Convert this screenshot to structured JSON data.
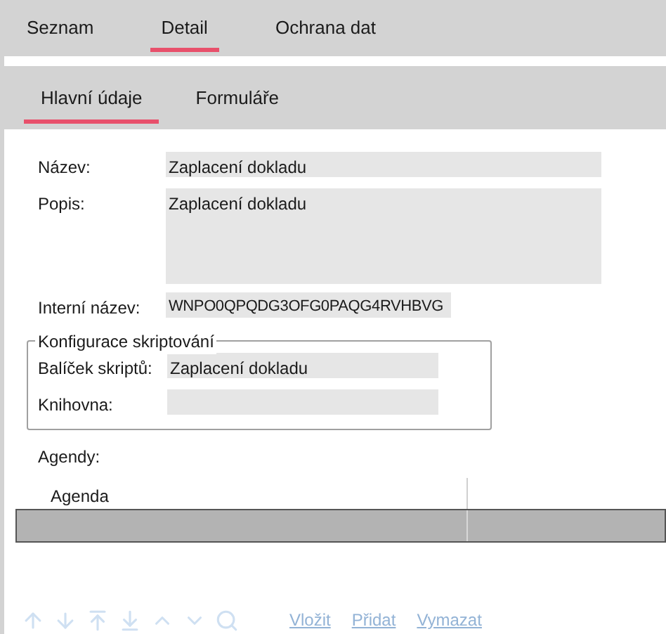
{
  "top_tabs": [
    {
      "label": "Seznam",
      "selected": false
    },
    {
      "label": "Detail",
      "selected": true
    },
    {
      "label": "Ochrana dat",
      "selected": false
    }
  ],
  "sub_tabs": [
    {
      "label": "Hlavní údaje",
      "selected": true
    },
    {
      "label": "Formuláře",
      "selected": false
    }
  ],
  "fields": [
    {
      "label": "Název:",
      "value": "Zaplacení dokladu",
      "kind": "text"
    },
    {
      "label": "Popis:",
      "value": "Zaplacení dokladu",
      "kind": "textarea"
    },
    {
      "label": "Interní název:",
      "value": "WNPO0QPQDG3OFG0PAQG4RVHBVG",
      "kind": "short"
    }
  ],
  "group": {
    "title": "Konfigurace skriptování",
    "fields": [
      {
        "label": "Balíček skriptů:",
        "value": "Zaplacení dokladu"
      },
      {
        "label": "Knihovna:"
      }
    ]
  },
  "agendas": {
    "label": "Agendy:",
    "columns": [
      "Agenda"
    ],
    "rows": [
      {
        "selected": true
      }
    ]
  },
  "nav_buttons": [
    {
      "kind": "up",
      "disabled": true
    },
    {
      "kind": "down",
      "disabled": true
    },
    {
      "kind": "first",
      "disabled": true
    },
    {
      "kind": "last",
      "disabled": true
    },
    {
      "kind": "prev",
      "disabled": true
    },
    {
      "kind": "next",
      "disabled": true
    },
    {
      "kind": "search",
      "disabled": true
    }
  ],
  "actions": [
    {
      "label": "Vložit",
      "disabled": true
    },
    {
      "label": "Přidat",
      "disabled": true
    },
    {
      "label": "Vymazat",
      "disabled": true
    }
  ]
}
